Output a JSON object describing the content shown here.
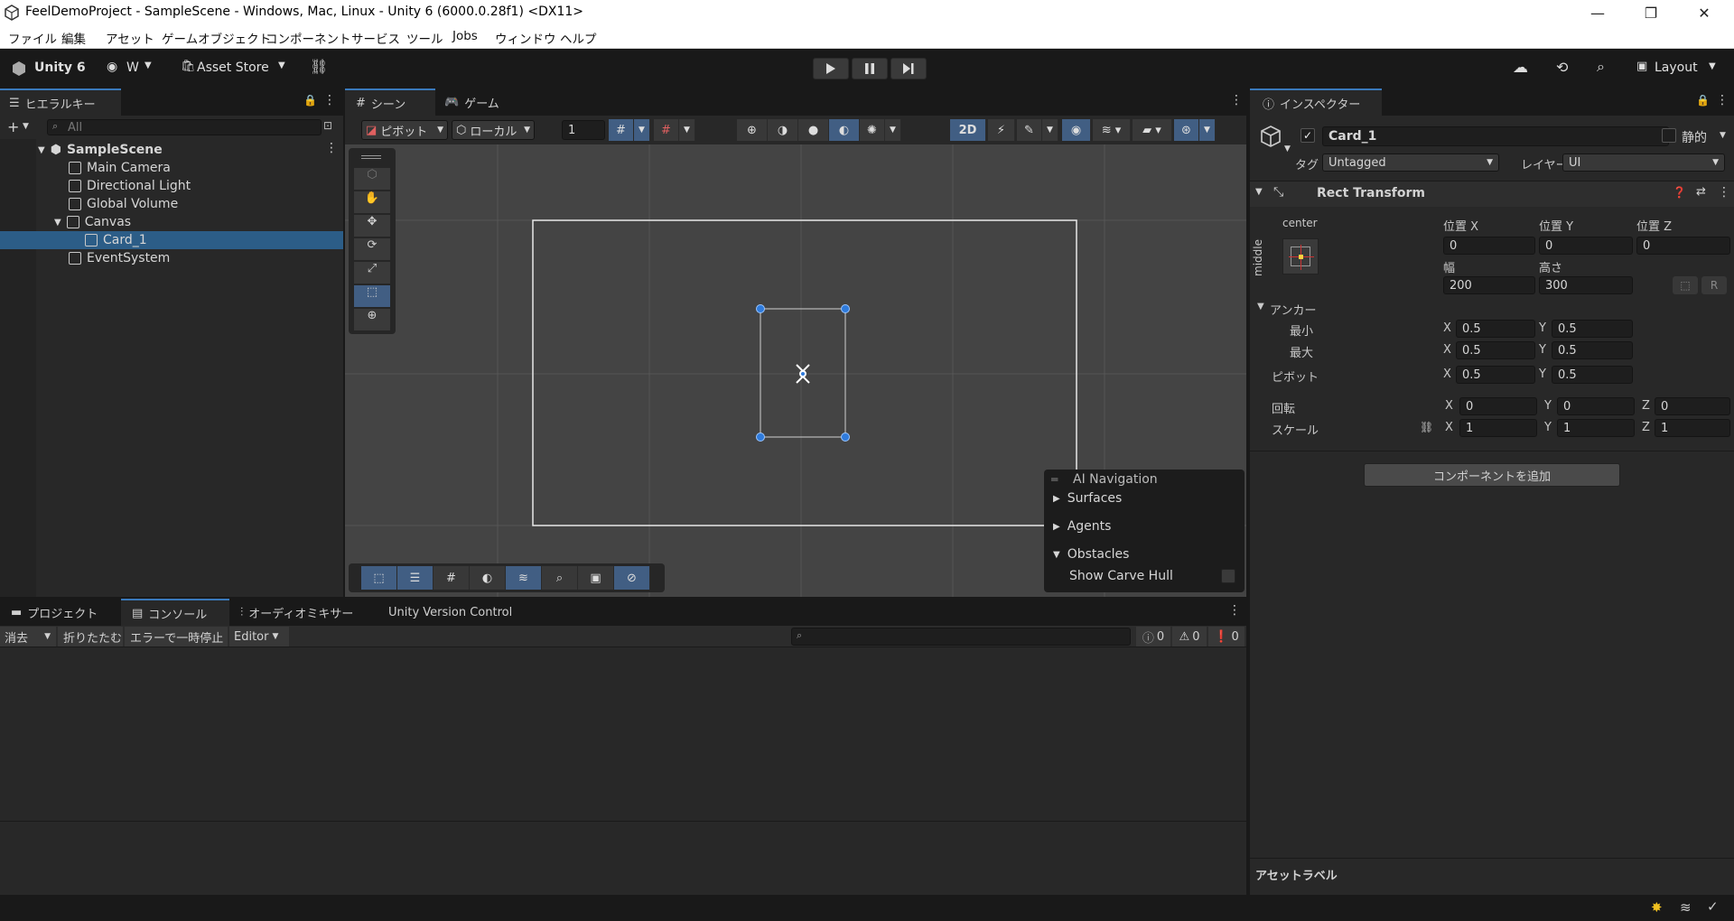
{
  "window": {
    "title": "FeelDemoProject - SampleScene - Windows, Mac, Linux - Unity 6 (6000.0.28f1) <DX11>"
  },
  "menu": [
    "ファイル",
    "編集",
    "アセット",
    "ゲームオブジェクト",
    "コンポーネント",
    "サービス",
    "ツール",
    "Jobs",
    "ウィンドウ",
    "ヘルプ"
  ],
  "toolbar": {
    "brand": "Unity 6",
    "account": "W",
    "asset_store": "Asset Store",
    "layout": "Layout"
  },
  "hierarchy": {
    "tab": "ヒエラルキー",
    "search_placeholder": "All",
    "scene": "SampleScene",
    "items": [
      {
        "label": "Main Camera"
      },
      {
        "label": "Directional Light"
      },
      {
        "label": "Global Volume"
      },
      {
        "label": "Canvas"
      },
      {
        "label": "Card_1"
      },
      {
        "label": "EventSystem"
      }
    ]
  },
  "scene": {
    "tabs": {
      "scene": "シーン",
      "game": "ゲーム"
    },
    "pivot": "ピボット",
    "local": "ローカル",
    "grid_value": "1",
    "mode_2d": "2D",
    "ai_nav": {
      "title": "AI Navigation",
      "items": [
        "Surfaces",
        "Agents",
        "Obstacles"
      ],
      "show_carve": "Show Carve Hull"
    }
  },
  "bottom": {
    "tabs": {
      "project": "プロジェクト",
      "console": "コンソール",
      "audio": "オーディオミキサー",
      "vc": "Unity Version Control"
    },
    "clear": "消去",
    "collapse": "折りたたむ",
    "pause_error": "エラーで一時停止",
    "editor": "Editor",
    "counts": {
      "info": "0",
      "warn": "0",
      "error": "0"
    }
  },
  "inspector": {
    "tab": "インスペクター",
    "name": "Card_1",
    "static": "静的",
    "tag_label": "タグ",
    "tag": "Untagged",
    "layer_label": "レイヤー",
    "layer": "UI",
    "component": "Rect Transform",
    "anchor_h": "center",
    "anchor_v": "middle",
    "pos_x_label": "位置 X",
    "pos_y_label": "位置 Y",
    "pos_z_label": "位置 Z",
    "pos_x": "0",
    "pos_y": "0",
    "pos_z": "0",
    "width_label": "幅",
    "height_label": "高さ",
    "width": "200",
    "height": "300",
    "raw_button": "R",
    "anchors": "アンカー",
    "min": "最小",
    "max": "最大",
    "pivot": "ピボット",
    "x": "X",
    "y": "Y",
    "z": "Z",
    "min_x": "0.5",
    "min_y": "0.5",
    "max_x": "0.5",
    "max_y": "0.5",
    "pivot_x": "0.5",
    "pivot_y": "0.5",
    "rotation": "回転",
    "rot_x": "0",
    "rot_y": "0",
    "rot_z": "0",
    "scale": "スケール",
    "scale_x": "1",
    "scale_y": "1",
    "scale_z": "1",
    "add_component": "コンポーネントを追加",
    "asset_labels": "アセットラベル"
  }
}
